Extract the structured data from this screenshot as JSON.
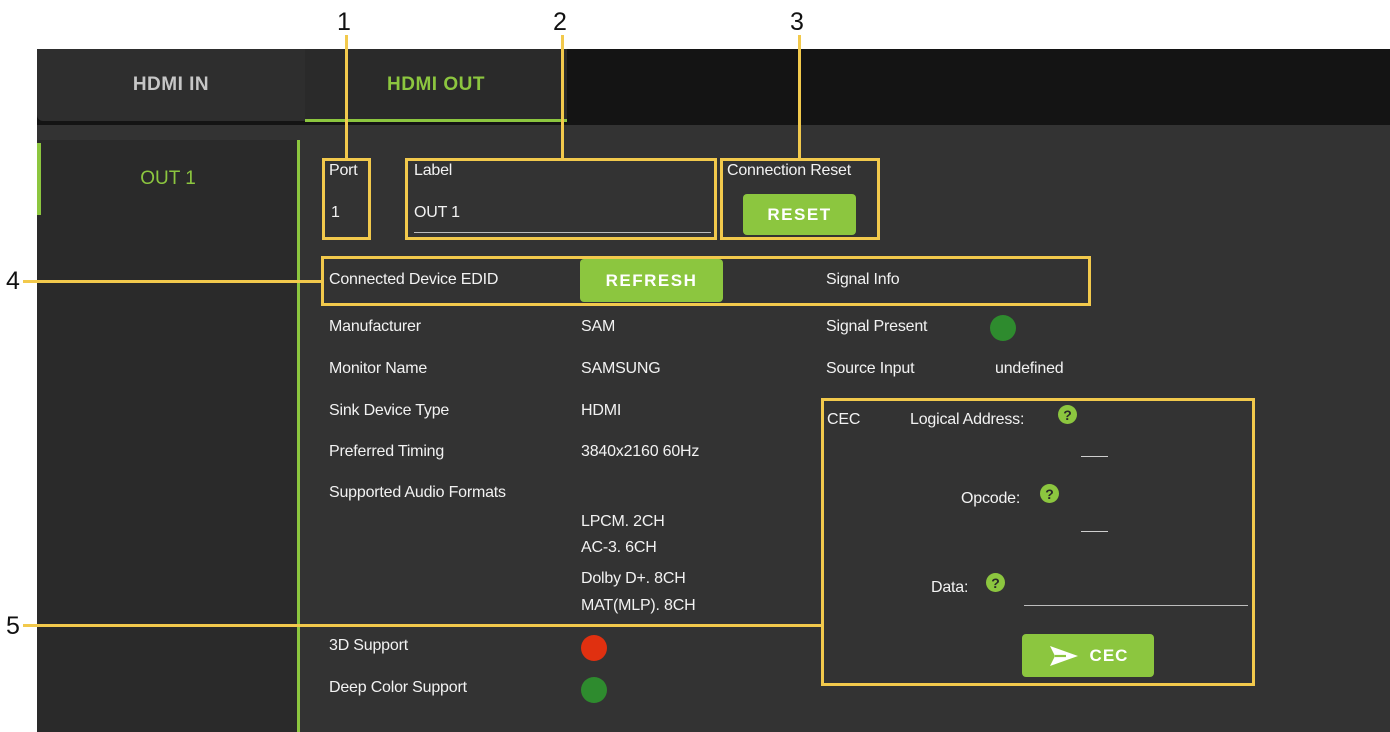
{
  "callouts": [
    "1",
    "2",
    "3",
    "4",
    "5"
  ],
  "tabs": {
    "in": "HDMI IN",
    "out": "HDMI OUT"
  },
  "sidebar": {
    "item": "OUT 1"
  },
  "port": {
    "label": "Port",
    "value": "1"
  },
  "label_field": {
    "label": "Label",
    "value": "OUT 1"
  },
  "connection_reset": {
    "label": "Connection Reset",
    "button": "RESET"
  },
  "edid": {
    "label": "Connected Device EDID",
    "button": "REFRESH"
  },
  "signal_info": {
    "label": "Signal Info"
  },
  "device": {
    "manufacturer_label": "Manufacturer",
    "manufacturer": "SAM",
    "monitor_label": "Monitor Name",
    "monitor": "SAMSUNG",
    "sink_label": "Sink Device Type",
    "sink": "HDMI",
    "timing_label": "Preferred Timing",
    "timing": "3840x2160 60Hz",
    "audio_label": "Supported Audio Formats",
    "audio_formats": [
      "LPCM. 2CH",
      "AC-3. 6CH",
      "Dolby D+. 8CH",
      "MAT(MLP). 8CH"
    ],
    "support_3d_label": "3D Support",
    "deep_color_label": "Deep Color Support"
  },
  "signal": {
    "present_label": "Signal Present",
    "source_label": "Source Input",
    "source": "undefined"
  },
  "cec": {
    "label": "CEC",
    "logical_address_label": "Logical Address:",
    "opcode_label": "Opcode:",
    "data_label": "Data:",
    "send_button": "CEC",
    "help_glyph": "?"
  },
  "colors": {
    "accent": "#8cc63f",
    "status_ok": "#2e8b2e",
    "status_bad": "#e03010",
    "annotation": "#f2c94c"
  },
  "status": {
    "signal_present": "ok",
    "support_3d": "bad",
    "deep_color": "ok"
  }
}
